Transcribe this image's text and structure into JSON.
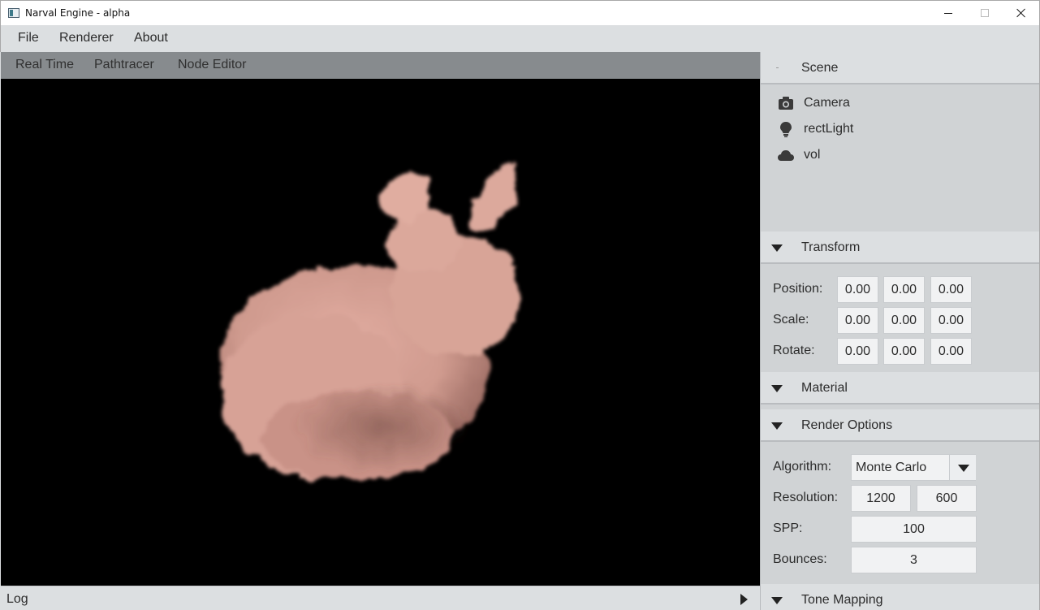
{
  "window": {
    "title": "Narval Engine - alpha"
  },
  "menubar": {
    "items": [
      "File",
      "Renderer",
      "About"
    ]
  },
  "viewport_tabs": [
    "Real Time",
    "Pathtracer",
    "Node Editor"
  ],
  "log": {
    "label": "Log"
  },
  "scene": {
    "title": "Scene",
    "items": [
      {
        "label": "Camera",
        "icon": "camera-icon"
      },
      {
        "label": "rectLight",
        "icon": "lightbulb-icon"
      },
      {
        "label": "vol",
        "icon": "cloud-icon"
      }
    ]
  },
  "transform": {
    "title": "Transform",
    "rows": [
      {
        "label": "Position:",
        "values": [
          "0.00",
          "0.00",
          "0.00"
        ]
      },
      {
        "label": "Scale:",
        "values": [
          "0.00",
          "0.00",
          "0.00"
        ]
      },
      {
        "label": "Rotate:",
        "values": [
          "0.00",
          "0.00",
          "0.00"
        ]
      }
    ]
  },
  "material": {
    "title": "Material"
  },
  "render_options": {
    "title": "Render Options",
    "algorithm_label": "Algorithm:",
    "algorithm_value": "Monte Carlo",
    "resolution_label": "Resolution:",
    "resolution_w": "1200",
    "resolution_h": "600",
    "spp_label": "SPP:",
    "spp_value": "100",
    "bounces_label": "Bounces:",
    "bounces_value": "3"
  },
  "tone_mapping": {
    "title": "Tone Mapping"
  },
  "colors": {
    "panel_bg": "#d0d3d5",
    "header_bg": "#dcdfe1",
    "tab_bg": "#878b8e",
    "viewport_bg": "#000000",
    "volume_color": "#d19a8f"
  }
}
